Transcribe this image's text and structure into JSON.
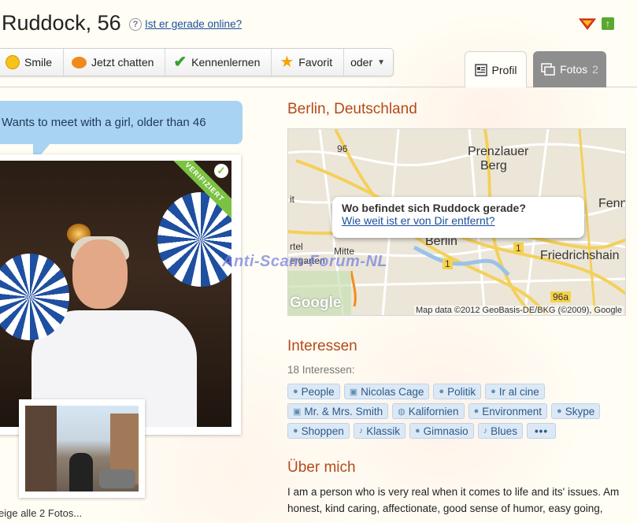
{
  "profile": {
    "name_age": "Ruddock, 56",
    "online_link": "Ist er gerade online?"
  },
  "actions": [
    {
      "label": "Smile",
      "icon": "smile-icon"
    },
    {
      "label": "Jetzt chatten",
      "icon": "chat-bubble-icon"
    },
    {
      "label": "Kennenlernen",
      "icon": "checkmark-icon"
    },
    {
      "label": "Favorit",
      "icon": "star-icon"
    },
    {
      "label": "oder",
      "icon": "caret-down-icon"
    }
  ],
  "tabs": {
    "profil": "Profil",
    "fotos": "Fotos",
    "fotos_count": "2"
  },
  "bubble": "Wants to meet with a girl, older than 46",
  "photo": {
    "badge": "VERIFIZIERT",
    "all_photos": "eige alle 2 Fotos..."
  },
  "location": "Berlin, Deutschland",
  "map": {
    "popup_question": "Wo befindet sich Ruddock gerade?",
    "popup_link": "Wie weit ist er von Dir entfernt?",
    "labels": {
      "prenzlauer": "Prenzlauer",
      "berg": "Berg",
      "berlin": "Berlin",
      "mitte": "Mitte",
      "friedrichshain": "Friedrichshain",
      "fennp": "Fennp",
      "rtel": "rtel",
      "ergarten": "ergarten",
      "it": "it",
      "road_96": "96",
      "road_96a": "96a",
      "road_1a": "1",
      "road_1b": "1"
    },
    "google": "Google",
    "attribution": "Map data ©2012 GeoBasis-DE/BKG (©2009), Google"
  },
  "watermark": "Anti-Scam-Forum-NL",
  "interests": {
    "heading": "Interessen",
    "count": "18 Interessen:",
    "tags": [
      {
        "label": "People",
        "icon": "bubble-icon"
      },
      {
        "label": "Nicolas Cage",
        "icon": "tv-icon"
      },
      {
        "label": "Politik",
        "icon": "bubble-icon"
      },
      {
        "label": "Ir al cine",
        "icon": "bubble-icon"
      },
      {
        "label": "Mr. & Mrs. Smith",
        "icon": "tv-icon"
      },
      {
        "label": "Kalifornien",
        "icon": "globe-icon"
      },
      {
        "label": "Environment",
        "icon": "bubble-icon"
      },
      {
        "label": "Skype",
        "icon": "bubble-icon"
      },
      {
        "label": "Shoppen",
        "icon": "bubble-icon"
      },
      {
        "label": "Klassik",
        "icon": "music-note-icon"
      },
      {
        "label": "Gimnasio",
        "icon": "bubble-icon"
      },
      {
        "label": "Blues",
        "icon": "music-note-icon"
      },
      {
        "label": "•••",
        "icon": ""
      }
    ]
  },
  "about": {
    "heading": "Über mich",
    "text": "I am a person who is very real when it comes to life and its' issues. Am honest, kind caring, affectionate, good sense of humor, easy going,"
  }
}
